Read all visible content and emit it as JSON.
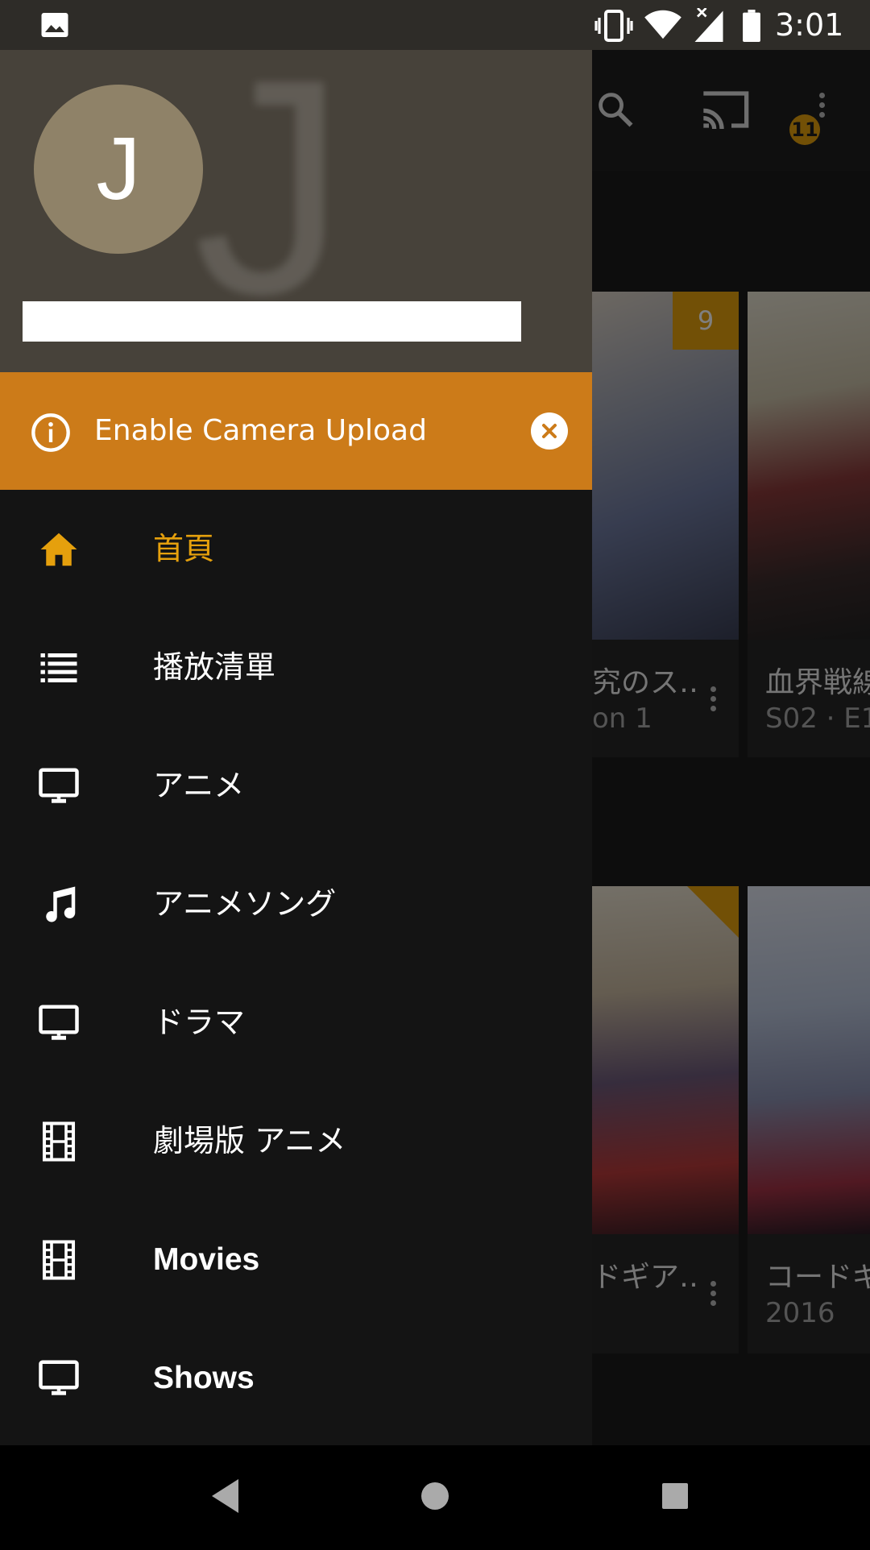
{
  "status_bar": {
    "time": "3:01",
    "icons": [
      "image-icon",
      "vibrate-icon",
      "wifi-icon",
      "signal-icon",
      "battery-icon"
    ]
  },
  "background_app": {
    "toolbar_icons": [
      "search-icon",
      "cast-icon",
      "more-vert-icon"
    ],
    "notification_badge": "11",
    "cards_row1": [
      {
        "title": "究のス‥",
        "subtitle": "on 1",
        "badge": "9"
      },
      {
        "title": "血界戦線",
        "subtitle": "S02 · E1"
      }
    ],
    "cards_row2": [
      {
        "title": "ドギア‥",
        "subtitle": ""
      },
      {
        "title": "コードギ",
        "subtitle": "2016"
      }
    ]
  },
  "drawer": {
    "avatar_initial": "J",
    "watermark_initial": "J",
    "account_name": "",
    "camera_banner": {
      "text": "Enable Camera Upload",
      "icon": "info-icon",
      "close_icon": "close-icon"
    },
    "items": [
      {
        "label": "首頁",
        "icon": "home-icon",
        "active": true
      },
      {
        "label": "播放清單",
        "icon": "list-icon"
      },
      {
        "label": "アニメ",
        "icon": "monitor-icon"
      },
      {
        "label": "アニメソング",
        "icon": "music-note-icon"
      },
      {
        "label": "ドラマ",
        "icon": "monitor-icon"
      },
      {
        "label": "劇場版 アニメ",
        "icon": "film-icon"
      },
      {
        "label": "Movies",
        "icon": "film-icon"
      },
      {
        "label": "Shows",
        "icon": "monitor-icon"
      }
    ]
  },
  "nav_bar": {
    "buttons": [
      "back-icon",
      "home-circle-icon",
      "recents-icon"
    ]
  },
  "colors": {
    "accent": "#e5a00d",
    "banner": "#cc7b19",
    "drawer_bg": "#141414",
    "header_bg": "#47423a",
    "avatar_bg": "#8f8268"
  }
}
